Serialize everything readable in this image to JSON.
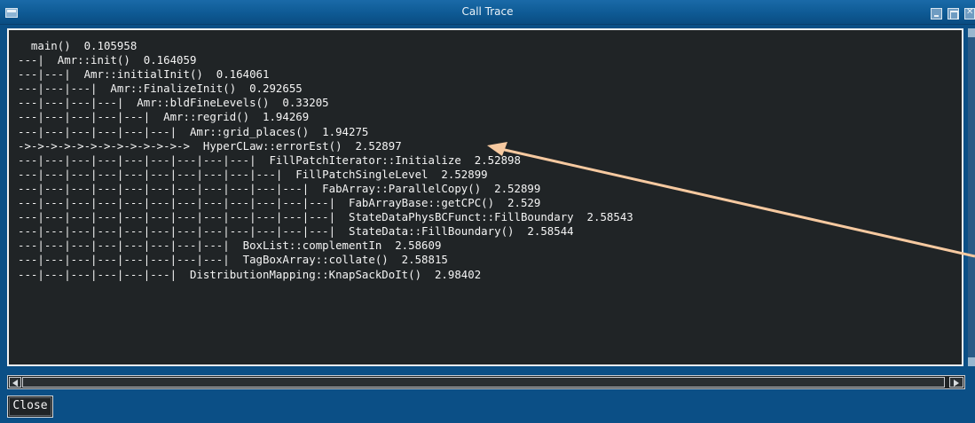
{
  "window": {
    "title": "Call Trace",
    "accent_color": "#0b4f86",
    "text_color": "#f4f4f4",
    "background_color": "#202426",
    "icons": [
      "window-menu-icon",
      "minimize-icon",
      "maximize-icon",
      "close-icon"
    ]
  },
  "trace": {
    "lines": [
      "  main()  0.105958",
      "---|  Amr::init()  0.164059",
      "---|---|  Amr::initialInit()  0.164061",
      "---|---|---|  Amr::FinalizeInit()  0.292655",
      "---|---|---|---|  Amr::bldFineLevels()  0.33205",
      "---|---|---|---|---|  Amr::regrid()  1.94269",
      "---|---|---|---|---|---|  Amr::grid_places()  1.94275",
      "->->->->->->->->->->->->->  HyperCLaw::errorEst()  2.52897",
      "---|---|---|---|---|---|---|---|---|  FillPatchIterator::Initialize  2.52898",
      "---|---|---|---|---|---|---|---|---|---|  FillPatchSingleLevel  2.52899",
      "---|---|---|---|---|---|---|---|---|---|---|  FabArray::ParallelCopy()  2.52899",
      "---|---|---|---|---|---|---|---|---|---|---|---|  FabArrayBase::getCPC()  2.529",
      "---|---|---|---|---|---|---|---|---|---|---|---|  StateDataPhysBCFunct::FillBoundary  2.58543",
      "---|---|---|---|---|---|---|---|---|---|---|---|  StateData::FillBoundary()  2.58544",
      "---|---|---|---|---|---|---|---|  BoxList::complementIn  2.58609",
      "---|---|---|---|---|---|---|---|  TagBoxArray::collate()  2.58815",
      "---|---|---|---|---|---|  DistributionMapping::KnapSackDoIt()  2.98402"
    ]
  },
  "footer": {
    "close_label": "Close"
  },
  "annotation": {
    "arrow_color": "#f6c9a0"
  }
}
